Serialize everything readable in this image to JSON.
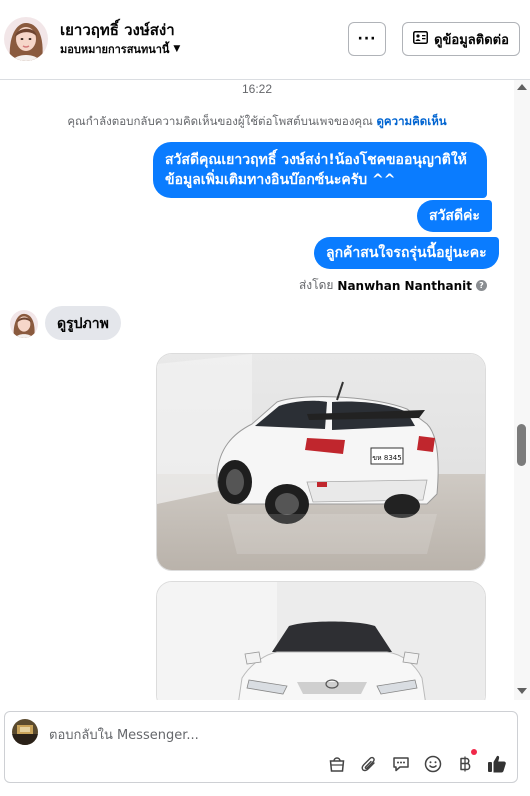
{
  "header": {
    "name": "เยาวฤทธิ์ วงษ์สง่า",
    "subtitle": "มอบหมายการสนทนานี้",
    "more_label": "···",
    "contact_label": "ดูข้อมูลติดต่อ"
  },
  "chat": {
    "timestamp": "16:22",
    "info_text": "คุณกำลังตอบกลับความคิดเห็นของผู้ใช้ต่อโพสต์บนเพจของคุณ",
    "info_link": "ดูความคิดเห็น",
    "outgoing": [
      "สวัสดีคุณเยาวฤทธิ์ วงษ์สง่า!น้องโชคขออนุญาติให้ข้อมูลเพิ่มเติมทางอินบ๊อกซ์นะครับ ^^",
      "สวัสดีค่ะ",
      "ลูกค้าสนใจรถรุ่นนี้อยู่นะคะ"
    ],
    "sent_by_label": "ส่งโดย",
    "sent_by_name": "Nanwhan Nanthanit",
    "incoming": "ดูรูปภาพ",
    "plate_text": "ขห 8345"
  },
  "composer": {
    "placeholder": "ตอบกลับใน Messenger..."
  },
  "icons": [
    "bag-icon",
    "paperclip-icon",
    "saved-reply-icon",
    "emoji-icon",
    "baht-icon",
    "like-icon"
  ],
  "colors": {
    "accent": "#0a7cff",
    "incoming_bg": "#e4e6eb",
    "link": "#0064d1",
    "notification": "#f02849"
  }
}
